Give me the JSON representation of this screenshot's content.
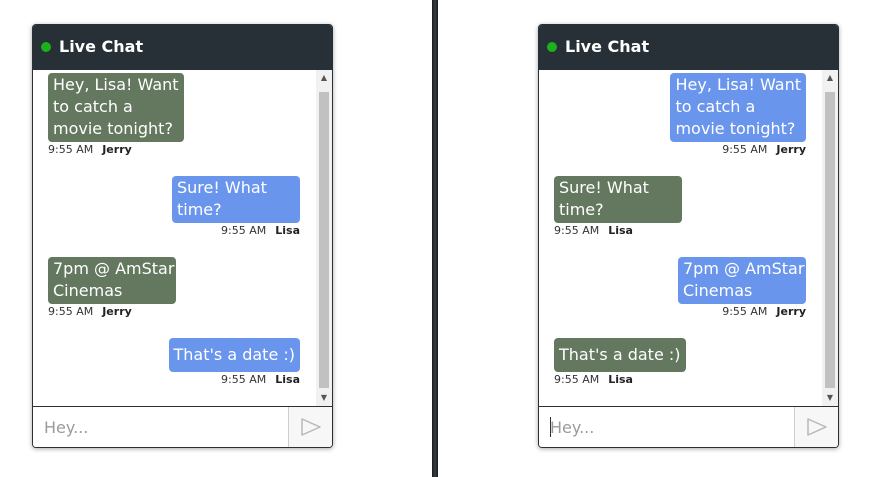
{
  "divider_color": "#2a2f35",
  "chats": [
    {
      "title": "Live Chat",
      "status_color": "#1cb01c",
      "input_placeholder": "Hey...",
      "messages": [
        {
          "lines": [
            "Hey, Lisa! Want",
            "to catch a",
            "movie tonight?"
          ],
          "time": "9:55 AM",
          "sender": "Jerry",
          "side": "left",
          "color": "green"
        },
        {
          "lines": [
            "Sure! What",
            "time?"
          ],
          "time": "9:55 AM",
          "sender": "Lisa",
          "side": "right",
          "color": "blue"
        },
        {
          "lines": [
            "7pm @ AmStar",
            "Cinemas"
          ],
          "time": "9:55 AM",
          "sender": "Jerry",
          "side": "left",
          "color": "green"
        },
        {
          "lines": [
            "That's a date :)"
          ],
          "time": "9:55 AM",
          "sender": "Lisa",
          "side": "right",
          "color": "blue"
        }
      ]
    },
    {
      "title": "Live Chat",
      "status_color": "#1cb01c",
      "input_placeholder": "Hey...",
      "messages": [
        {
          "lines": [
            "Hey, Lisa! Want",
            "to catch a",
            "movie tonight?"
          ],
          "time": "9:55 AM",
          "sender": "Jerry",
          "side": "right",
          "color": "blue"
        },
        {
          "lines": [
            "Sure! What",
            "time?"
          ],
          "time": "9:55 AM",
          "sender": "Lisa",
          "side": "left",
          "color": "green"
        },
        {
          "lines": [
            "7pm @ AmStar",
            "Cinemas"
          ],
          "time": "9:55 AM",
          "sender": "Jerry",
          "side": "right",
          "color": "blue"
        },
        {
          "lines": [
            "That's a date :)"
          ],
          "time": "9:55 AM",
          "sender": "Lisa",
          "side": "left",
          "color": "green"
        }
      ]
    }
  ],
  "icons": {
    "status": "online-dot-icon",
    "send": "send-arrow-icon",
    "scroll_up": "scroll-up-arrow-icon",
    "scroll_down": "scroll-down-arrow-icon"
  }
}
